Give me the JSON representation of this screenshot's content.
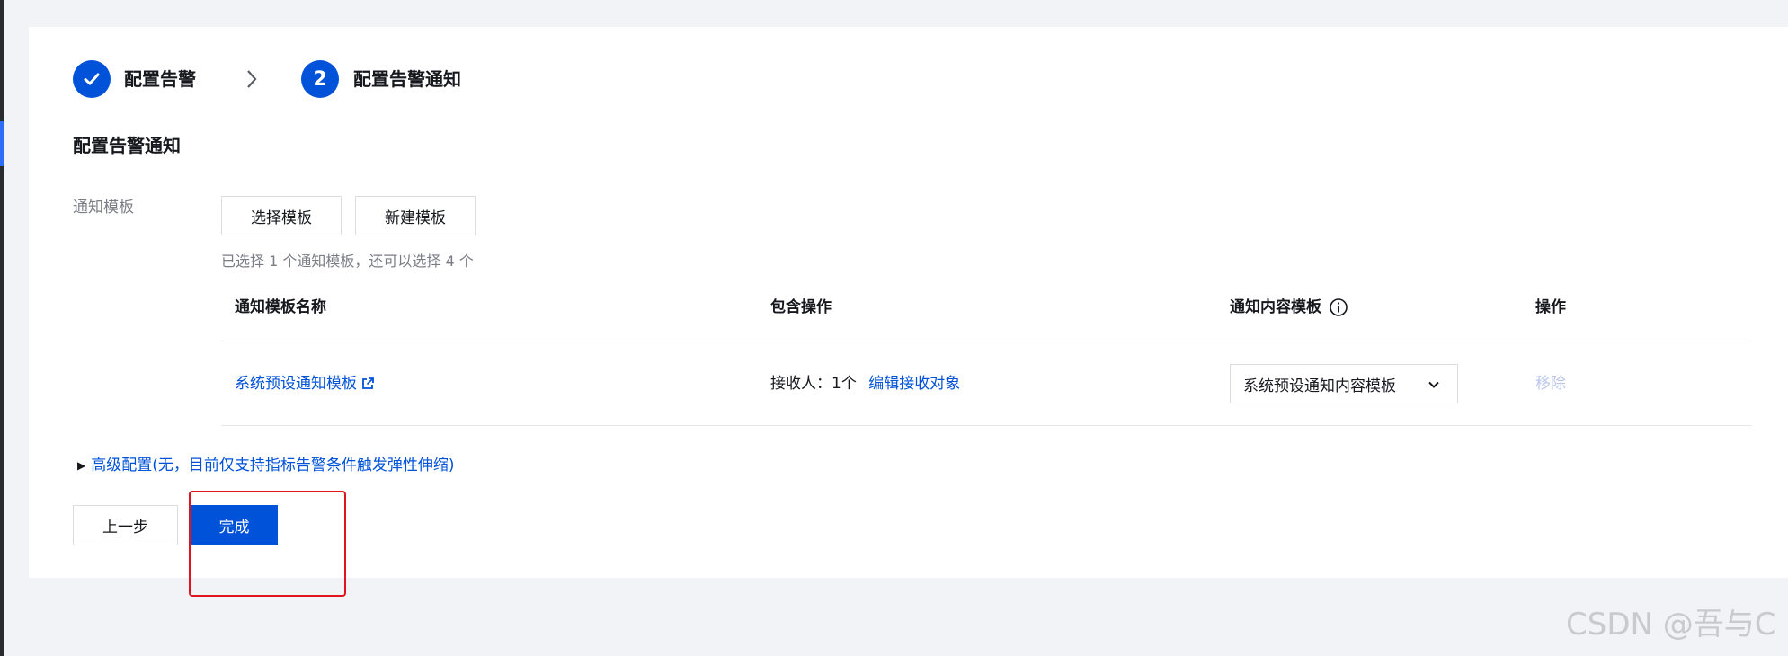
{
  "steps": [
    {
      "label": "配置告警",
      "state": "done"
    },
    {
      "number": "2",
      "label": "配置告警通知",
      "state": "active"
    }
  ],
  "section_title": "配置告警通知",
  "notify_template": {
    "label": "通知模板",
    "select_button": "选择模板",
    "new_button": "新建模板",
    "hint": "已选择 1 个通知模板，还可以选择 4 个"
  },
  "table": {
    "headers": [
      "通知模板名称",
      "包含操作",
      "通知内容模板",
      "操作"
    ],
    "rows": [
      {
        "name": "系统预设通知模板",
        "receivers_label": "接收人：1个",
        "edit_link": "编辑接收对象",
        "content_template": "系统预设通知内容模板",
        "action": "移除"
      }
    ]
  },
  "advanced": {
    "label": "高级配置(无，目前仅支持指标告警条件触发弹性伸缩)"
  },
  "footer": {
    "prev": "上一步",
    "finish": "完成"
  },
  "watermark": "CSDN @吾与C",
  "colors": {
    "primary": "#0052d9",
    "highlight": "#e0141e",
    "disabled_link": "#bcc6ea"
  },
  "icons": [
    "check-icon",
    "chevron-right-icon",
    "external-link-icon",
    "info-icon",
    "chevron-down-icon",
    "caret-right-icon"
  ]
}
